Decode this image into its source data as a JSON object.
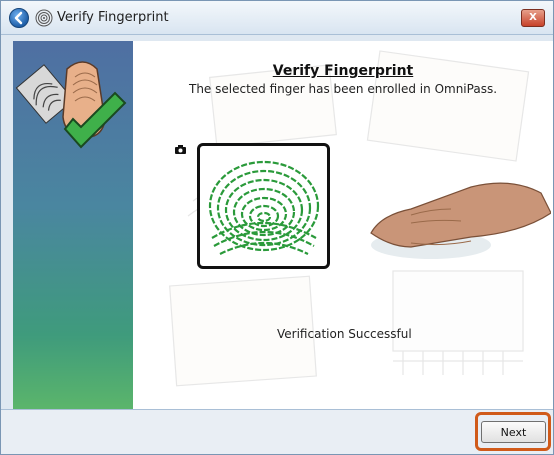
{
  "window": {
    "title": "Verify Fingerprint",
    "close_label": "X"
  },
  "content": {
    "heading": "Verify Fingerprint",
    "subheading": "The selected finger has been enrolled in OmniPass.",
    "status": "Verification Successful"
  },
  "footer": {
    "next_label": "Next"
  },
  "colors": {
    "highlight": "#d05a1a",
    "print_green": "#2a9a3a",
    "sidebar_top": "#4f6fa2",
    "sidebar_bottom": "#5bb56b"
  },
  "icons": {
    "back": "back-arrow-icon",
    "app": "fingerprint-icon",
    "close": "close-icon",
    "camera": "camera-icon",
    "enroll": "fingerprint-check-icon"
  }
}
